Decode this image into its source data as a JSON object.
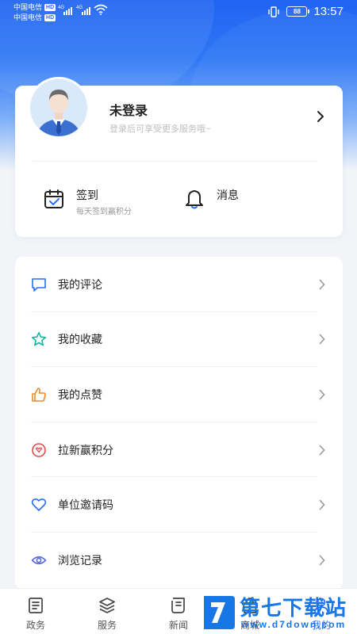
{
  "status_bar": {
    "carrier_1": "中国电信",
    "carrier_2": "中国电信",
    "hd_badge": "HD",
    "network_type": "4G",
    "battery_level": "88",
    "time": "13:57"
  },
  "profile": {
    "name": "未登录",
    "subtitle": "登录后可享受更多服务哦~",
    "avatar_icon": "user-avatar-icon",
    "chevron_icon": "chevron-right-icon"
  },
  "quick_actions": [
    {
      "label": "签到",
      "sub": "每天签到赢积分",
      "icon": "calendar-check-icon"
    },
    {
      "label": "消息",
      "sub": "",
      "icon": "bell-icon"
    }
  ],
  "menu": [
    {
      "label": "我的评论",
      "icon": "comment-icon",
      "color": "#2a6ef4"
    },
    {
      "label": "我的收藏",
      "icon": "star-icon",
      "color": "#17b3a3"
    },
    {
      "label": "我的点赞",
      "icon": "thumb-up-icon",
      "color": "#f08a24"
    },
    {
      "label": "拉新赢积分",
      "icon": "heart-badge-icon",
      "color": "#e5484d"
    },
    {
      "label": "单位邀请码",
      "icon": "heart-icon",
      "color": "#2a6ef4"
    },
    {
      "label": "浏览记录",
      "icon": "eye-icon",
      "color": "#5a6bd8"
    }
  ],
  "tabs": [
    {
      "label": "政务",
      "icon": "government-icon"
    },
    {
      "label": "服务",
      "icon": "layers-icon"
    },
    {
      "label": "新闻",
      "icon": "news-icon"
    },
    {
      "label": "商城",
      "icon": "shop-icon"
    },
    {
      "label": "我的",
      "icon": "person-icon"
    }
  ],
  "watermark": {
    "title": "第七下载站",
    "url": "www.d7down.com"
  },
  "colors": {
    "accent": "#2a6ef4",
    "header_blue": "#1f64f2",
    "background": "#f2f4f8",
    "watermark": "#1677e5"
  }
}
